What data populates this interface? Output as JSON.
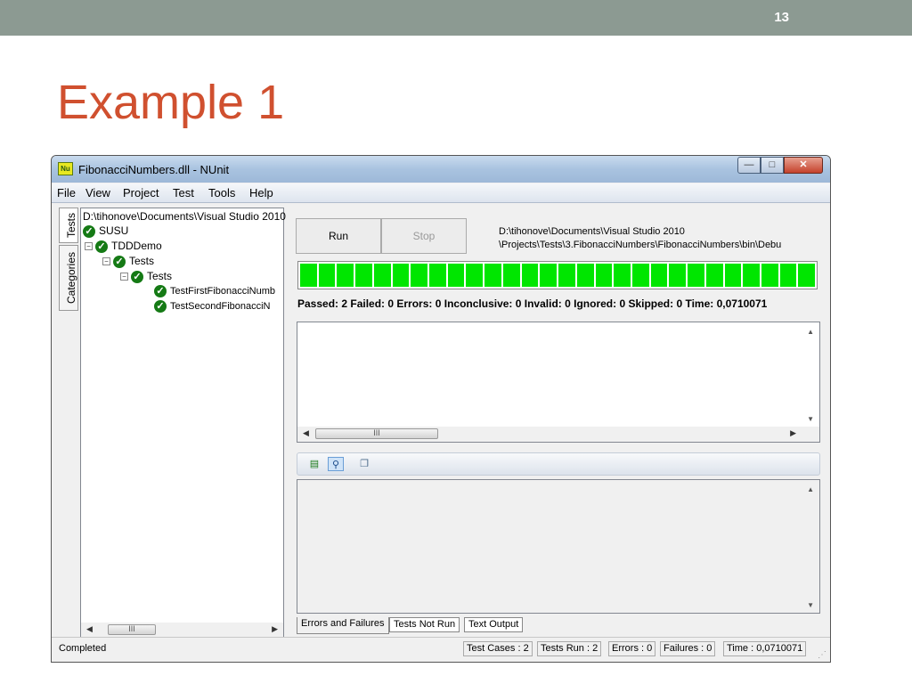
{
  "slide": {
    "number": "13",
    "title": "Example 1"
  },
  "window": {
    "title": "FibonacciNumbers.dll - NUnit",
    "icon_label": "Nu",
    "controls": {
      "minimize": "—",
      "maximize": "□",
      "close": "✕"
    }
  },
  "menu": [
    "File",
    "View",
    "Project",
    "Test",
    "Tools",
    "Help"
  ],
  "side_tabs": {
    "tests": "Tests",
    "categories": "Categories"
  },
  "tree": {
    "root_path": "D:\\tihonove\\Documents\\Visual Studio 2010",
    "items": [
      {
        "label": "SUSU",
        "level": 0
      },
      {
        "label": "TDDDemo",
        "level": 1
      },
      {
        "label": "Tests",
        "level": 2
      },
      {
        "label": "Tests",
        "level": 3
      },
      {
        "label": "TestFirstFibonacciNumb",
        "level": 4
      },
      {
        "label": "TestSecondFibonacciN",
        "level": 4
      }
    ],
    "scroll_thumb": "III"
  },
  "controls": {
    "run_label": "Run",
    "stop_label": "Stop",
    "path_line1": "D:\\tihonove\\Documents\\Visual Studio 2010",
    "path_line2": "\\Projects\\Tests\\3.FibonacciNumbers\\FibonacciNumbers\\bin\\Debu"
  },
  "progress": {
    "fraction": 1.0,
    "color": "#00e600"
  },
  "summary": "Passed: 2  Failed: 0  Errors: 0  Inconclusive: 0  Invalid: 0  Ignored: 0  Skipped: 0  Time: 0,0710071",
  "output_scroll_thumb": "III",
  "toolbar_icons": [
    "copy-icon",
    "search-icon",
    "clipboard-icon"
  ],
  "bottom_tabs": [
    "Errors and Failures",
    "Tests Not Run",
    "Text Output"
  ],
  "status": {
    "left": "Completed",
    "test_cases": "Test Cases : 2",
    "tests_run": "Tests Run : 2",
    "errors": "Errors : 0",
    "failures": "Failures : 0",
    "time": "Time : 0,0710071"
  }
}
